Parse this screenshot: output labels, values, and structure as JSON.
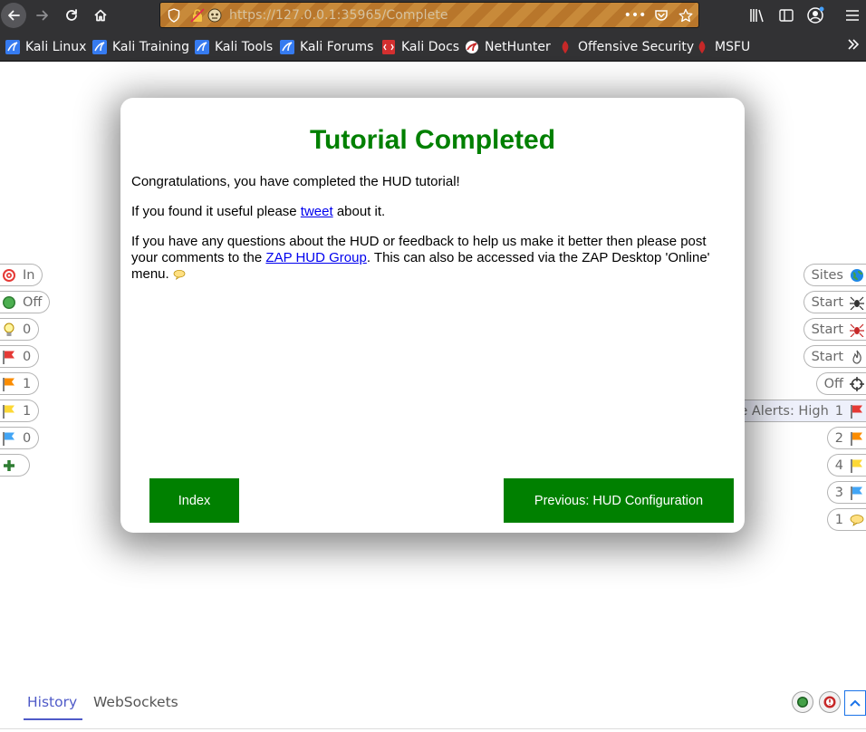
{
  "browser": {
    "url": "https://127.0.0.1:35965/Complete",
    "bookmarks": [
      "Kali Linux",
      "Kali Training",
      "Kali Tools",
      "Kali Forums",
      "Kali Docs",
      "NetHunter",
      "Offensive Security",
      "MSFU"
    ]
  },
  "modal": {
    "title": "Tutorial Completed",
    "p1": "Congratulations, you have completed the HUD tutorial!",
    "p2_before": "If you found it useful please ",
    "p2_link": "tweet",
    "p2_after": " about it.",
    "p3_before": "If you have any questions about the HUD or feedback to help us make it better then please post your comments to the ",
    "p3_link": "ZAP HUD Group",
    "p3_after": ". This can also be accessed via the ZAP Desktop 'Online' menu.",
    "index_button": "Index",
    "prev_button": "Previous: HUD Configuration"
  },
  "hud_left": [
    {
      "label": "In",
      "icon": "target-icon"
    },
    {
      "label": "Off",
      "icon": "green-dot-icon"
    },
    {
      "label": "0",
      "icon": "lightbulb-icon"
    },
    {
      "label": "0",
      "icon": "red-flag-icon"
    },
    {
      "label": "1",
      "icon": "orange-flag-icon"
    },
    {
      "label": "1",
      "icon": "yellow-flag-icon"
    },
    {
      "label": "0",
      "icon": "blue-flag-icon"
    },
    {
      "label": "",
      "icon": "plus-icon"
    }
  ],
  "hud_right": [
    {
      "label": "Sites",
      "icon": "globe-icon"
    },
    {
      "label": "Start",
      "icon": "spider-icon"
    },
    {
      "label": "Start",
      "icon": "ajax-spider-icon"
    },
    {
      "label": "Start",
      "icon": "flame-icon"
    },
    {
      "label": "Off",
      "icon": "crosshair-icon"
    },
    {
      "label": "Site Alerts: High",
      "count": "1",
      "icon": "red-flag-icon"
    },
    {
      "label": "2",
      "icon": "orange-flag-icon"
    },
    {
      "label": "4",
      "icon": "yellow-flag-icon"
    },
    {
      "label": "3",
      "icon": "blue-flag-icon"
    },
    {
      "label": "1",
      "icon": "comment-icon"
    }
  ],
  "drawer": {
    "tabs": [
      "History",
      "WebSockets"
    ]
  },
  "colors": {
    "title_green": "#008000",
    "button_green": "#008000",
    "tab_active": "#4f5ac8",
    "chrome_dark": "#323234"
  }
}
